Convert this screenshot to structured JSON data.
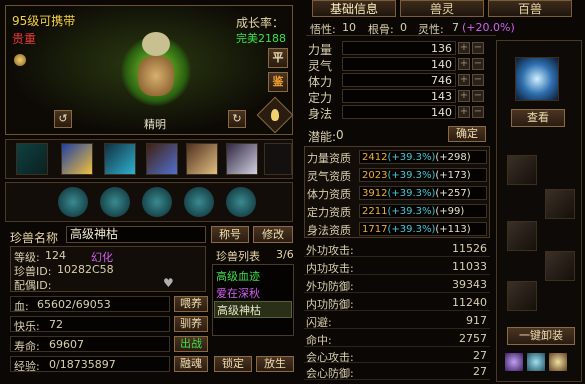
{
  "pet_header": {
    "level_name": "95级可携带",
    "rarity": "贵重",
    "growth_label": "成长率：",
    "growth_value": "完美2188",
    "personality": "精明",
    "ping_label": "平",
    "jian_label": "鉴"
  },
  "tabs": [
    "基础信息",
    "兽灵",
    "百兽"
  ],
  "attr_header": {
    "wuxing_label": "悟性:",
    "wuxing": "10",
    "gengu_label": "根骨:",
    "gengu": "0",
    "lingxing_label": "灵性:",
    "lingxing": "7",
    "lingxing_bonus": "(+20.0%)"
  },
  "stats": [
    {
      "label": "力量",
      "value": "136"
    },
    {
      "label": "灵气",
      "value": "140"
    },
    {
      "label": "体力",
      "value": "746"
    },
    {
      "label": "定力",
      "value": "143"
    },
    {
      "label": "身法",
      "value": "140"
    }
  ],
  "potential": {
    "label": "潜能:",
    "value": "0",
    "confirm": "确定"
  },
  "aptitudes": [
    {
      "label": "力量资质",
      "base": "2412",
      "pct": "(+39.3%)",
      "add": "(+298)"
    },
    {
      "label": "灵气资质",
      "base": "2023",
      "pct": "(+39.3%)",
      "add": "(+173)"
    },
    {
      "label": "体力资质",
      "base": "3912",
      "pct": "(+39.3%)",
      "add": "(+257)"
    },
    {
      "label": "定力资质",
      "base": "2211",
      "pct": "(+39.3%)",
      "add": "(+99)"
    },
    {
      "label": "身法资质",
      "base": "1717",
      "pct": "(+39.3%)",
      "add": "(+113)"
    }
  ],
  "combat": [
    {
      "label": "外功攻击:",
      "value": "11526"
    },
    {
      "label": "内功攻击:",
      "value": "11033"
    },
    {
      "label": "外功防御:",
      "value": "39343"
    },
    {
      "label": "内功防御:",
      "value": "11240"
    },
    {
      "label": "闪避:",
      "value": "917"
    },
    {
      "label": "命中:",
      "value": "2757"
    },
    {
      "label": "会心攻击:",
      "value": "27"
    },
    {
      "label": "会心防御:",
      "value": "27"
    }
  ],
  "pet_name": {
    "label": "珍兽名称",
    "value": "高级神枯",
    "rename": "称号",
    "modify": "修改"
  },
  "info": {
    "level_label": "等级:",
    "level": "124",
    "status": "幻化",
    "id_label": "珍兽ID:",
    "id": "10282C58",
    "spouse_label": "配偶ID:",
    "spouse": ""
  },
  "pet_list": {
    "title": "珍兽列表",
    "count": "3/6",
    "items": [
      "高级血迹",
      "爱在深秋",
      "高级神枯"
    ]
  },
  "bars": [
    {
      "label": "血:",
      "value": "65602/69053",
      "btn": "喂养"
    },
    {
      "label": "快乐:",
      "value": "72",
      "btn": "驯养"
    },
    {
      "label": "寿命:",
      "value": "69607",
      "btn": "出战"
    },
    {
      "label": "经验:",
      "value": "0/18735897",
      "btn": "融魂"
    }
  ],
  "bottom_buttons": [
    "锁定",
    "放生"
  ],
  "right_panel": {
    "view": "查看",
    "unequip_all": "一键卸装"
  },
  "colors": {
    "gold": "#f0b030",
    "green": "#3ee04a",
    "red": "#e83a3a",
    "purple": "#d060f0",
    "cyan": "#3ec8d8"
  }
}
